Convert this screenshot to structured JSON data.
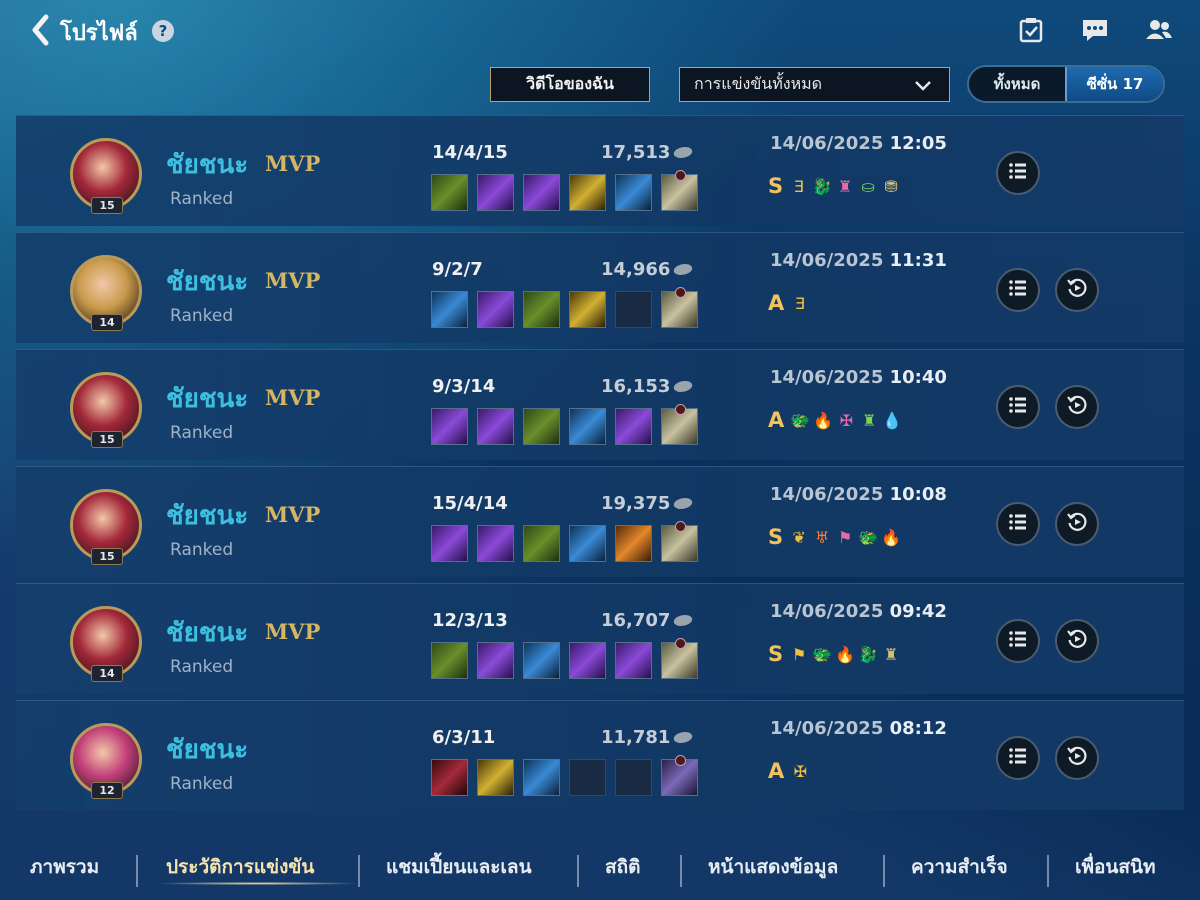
{
  "header": {
    "title": "โปรไฟล์",
    "help": "?"
  },
  "filters": {
    "video_button": "วิดีโอของฉัน",
    "mode_select": "การแข่งขันทั้งหมด",
    "season_all": "ทั้งหมด",
    "season_current": "ซีซั่น 17"
  },
  "matches": [
    {
      "result": "ชัยชนะ",
      "mvp": "MVP",
      "mode": "Ranked",
      "level": "15",
      "kda": "14/4/15",
      "gold": "17,513",
      "date": "14/06/2025",
      "time": "12:05",
      "grade": "S",
      "medals": [
        "Ǝ",
        "🐉",
        "♜",
        "⛀",
        "⛃"
      ],
      "items": [
        "green",
        "purple",
        "purple",
        "gold",
        "blue",
        "boots"
      ],
      "has_replay": false,
      "avatar_color": "#a3283a"
    },
    {
      "result": "ชัยชนะ",
      "mvp": "MVP",
      "mode": "Ranked",
      "level": "14",
      "kda": "9/2/7",
      "gold": "14,966",
      "date": "14/06/2025",
      "time": "11:31",
      "grade": "A",
      "medals": [
        "Ǝ"
      ],
      "items": [
        "blue",
        "purple",
        "green",
        "gold",
        "empty",
        "boots"
      ],
      "has_replay": true,
      "avatar_color": "#c99a4b"
    },
    {
      "result": "ชัยชนะ",
      "mvp": "MVP",
      "mode": "Ranked",
      "level": "15",
      "kda": "9/3/14",
      "gold": "16,153",
      "date": "14/06/2025",
      "time": "10:40",
      "grade": "A",
      "medals": [
        "🐲",
        "🔥",
        "✠",
        "♜",
        "💧"
      ],
      "items": [
        "purple",
        "purple",
        "green",
        "blue",
        "purple",
        "boots"
      ],
      "has_replay": true,
      "avatar_color": "#a3283a"
    },
    {
      "result": "ชัยชนะ",
      "mvp": "MVP",
      "mode": "Ranked",
      "level": "15",
      "kda": "15/4/14",
      "gold": "19,375",
      "date": "14/06/2025",
      "time": "10:08",
      "grade": "S",
      "medals": [
        "❦",
        "♅",
        "⚑",
        "🐲",
        "🔥"
      ],
      "items": [
        "purple",
        "purple",
        "green",
        "blue",
        "orange",
        "boots"
      ],
      "has_replay": true,
      "avatar_color": "#a3283a"
    },
    {
      "result": "ชัยชนะ",
      "mvp": "MVP",
      "mode": "Ranked",
      "level": "14",
      "kda": "12/3/13",
      "gold": "16,707",
      "date": "14/06/2025",
      "time": "09:42",
      "grade": "S",
      "medals": [
        "⚑",
        "🐲",
        "🔥",
        "🐉",
        "♜"
      ],
      "items": [
        "green",
        "purple",
        "blue",
        "purple",
        "purple",
        "boots"
      ],
      "has_replay": true,
      "avatar_color": "#a3283a"
    },
    {
      "result": "ชัยชนะ",
      "mvp": "",
      "mode": "Ranked",
      "level": "12",
      "kda": "6/3/11",
      "gold": "11,781",
      "date": "14/06/2025",
      "time": "08:12",
      "grade": "A",
      "medals": [
        "✠"
      ],
      "items": [
        "red",
        "gold",
        "blue",
        "empty",
        "empty",
        "boots2"
      ],
      "has_replay": true,
      "avatar_color": "#c2407a"
    }
  ],
  "bottom_nav": [
    {
      "label": "ภาพรวม"
    },
    {
      "label": "ประวัติการแข่งขัน"
    },
    {
      "label": "แชมเปี้ยนและเลน"
    },
    {
      "label": "สถิติ"
    },
    {
      "label": "หน้าแสดงข้อมูล"
    },
    {
      "label": "ความสำเร็จ"
    },
    {
      "label": "เพื่อนสนิท"
    }
  ],
  "colors": {
    "accent_win": "#3dbfe0",
    "mvp_gold": "#d6b663",
    "grade": "#f2c35c"
  },
  "icons": {
    "back": "chevron-left-icon",
    "tasks": "checklist-icon",
    "chat": "chat-icon",
    "friends": "friends-icon",
    "detail": "list-icon",
    "replay": "replay-icon"
  }
}
